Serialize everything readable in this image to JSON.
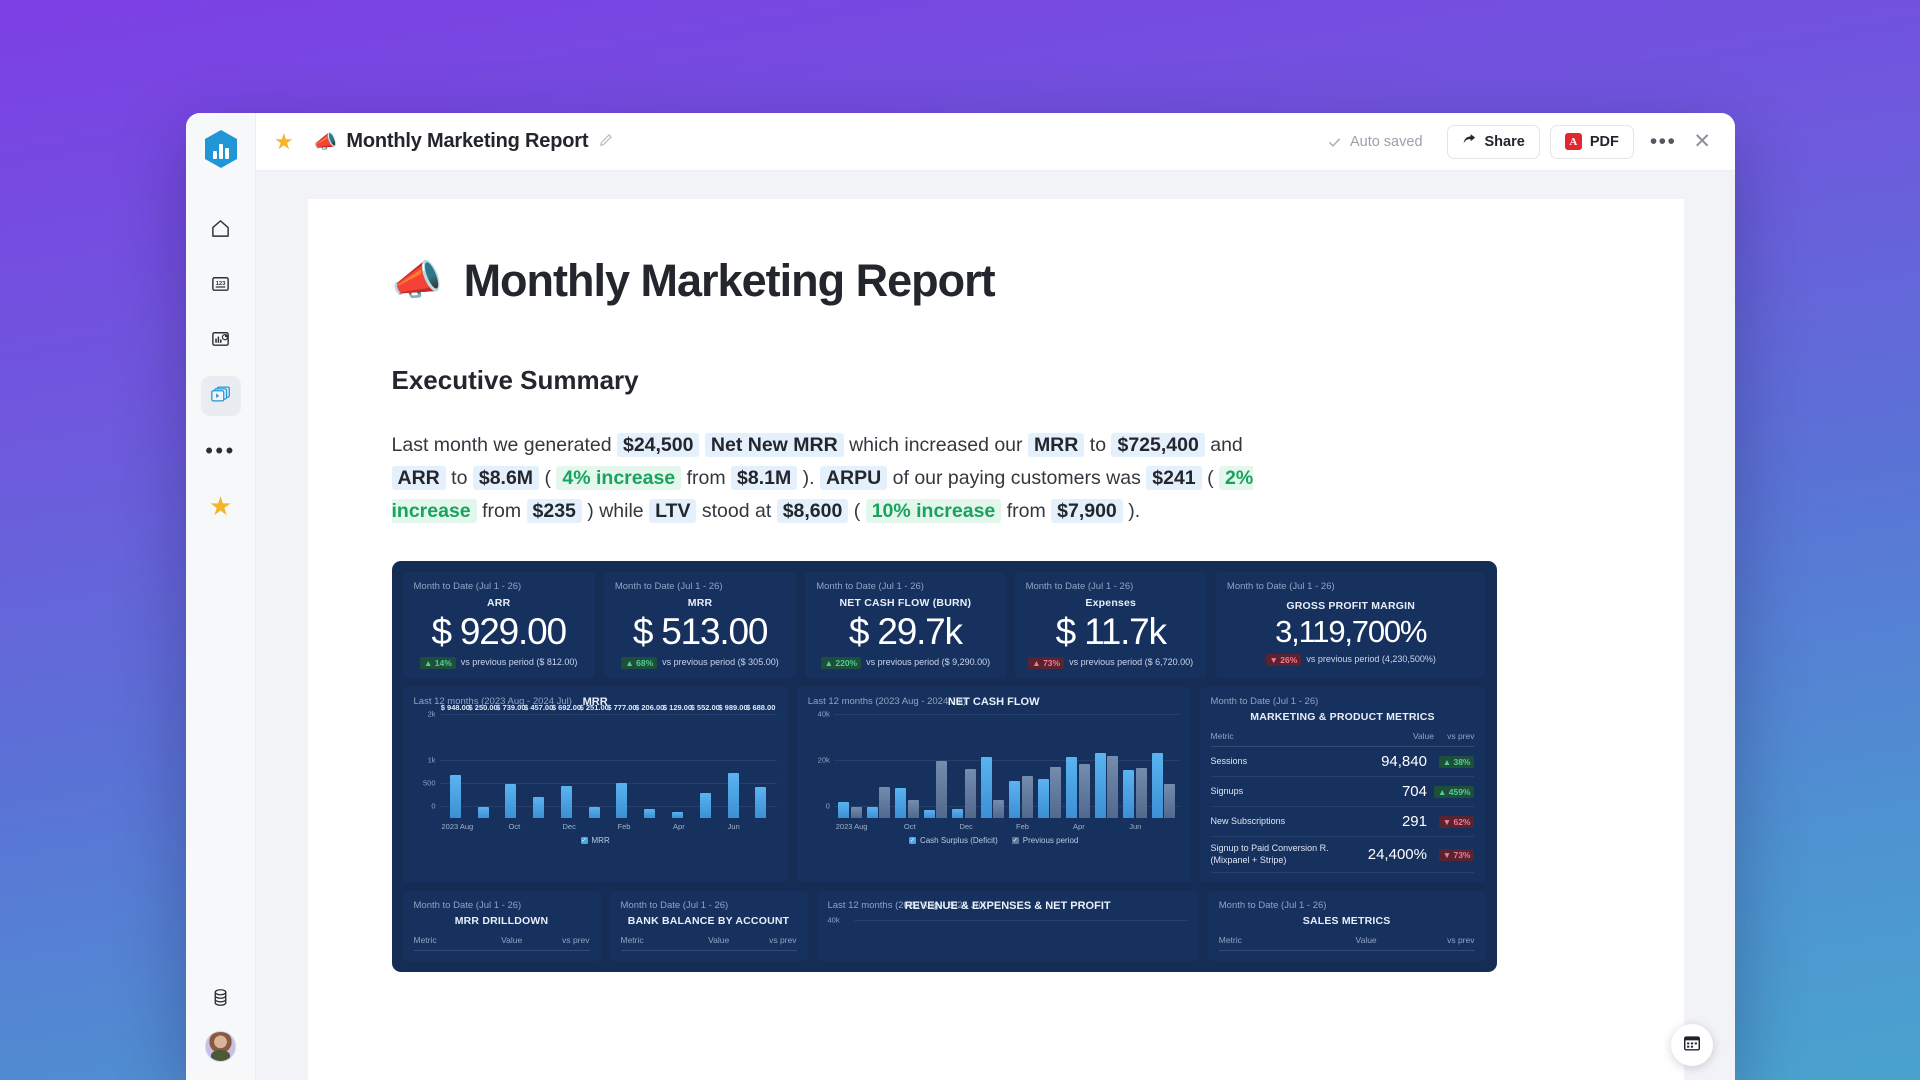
{
  "app": {
    "logo_icon": "hexagon-bar-chart-logo",
    "rail_items": [
      {
        "name": "home",
        "icon": "home-icon",
        "active": false
      },
      {
        "name": "metrics",
        "icon": "numbers-123-icon",
        "active": false
      },
      {
        "name": "dashboards",
        "icon": "dashboard-chart-icon",
        "active": false
      },
      {
        "name": "reports",
        "icon": "slideshow-icon",
        "active": true
      },
      {
        "name": "more",
        "icon": "ellipsis-icon",
        "active": false
      },
      {
        "name": "favorites",
        "icon": "star-icon",
        "active": false
      }
    ],
    "rail_bottom": [
      {
        "name": "data-sources",
        "icon": "database-icon"
      },
      {
        "name": "user-avatar",
        "icon": "avatar"
      }
    ]
  },
  "topbar": {
    "star_icon": "star-icon",
    "doc_emoji": "📣",
    "title": "Monthly Marketing Report",
    "edit_icon": "pencil-icon",
    "autosave_label": "Auto saved",
    "autosave_icon": "check-icon",
    "share_label": "Share",
    "share_icon": "share-arrow-icon",
    "pdf_label": "PDF",
    "pdf_badge_text": "A",
    "more_icon": "ellipsis-icon",
    "close_icon": "close-icon"
  },
  "document": {
    "emoji": "📣",
    "title": "Monthly Marketing Report",
    "section_heading": "Executive Summary",
    "summary": {
      "t1": "Last month we generated ",
      "v_netnew_amount": "$24,500",
      "v_netnew_label": "Net New MRR",
      "t2": " which increased our ",
      "v_mrr_label": "MRR",
      "t3": " to ",
      "v_mrr_amount": "$725,400",
      "t4": " and ",
      "v_arr_label": "ARR",
      "t5": " to ",
      "v_arr_amount": "$8.6M",
      "t6": " ( ",
      "v_arr_change": "4% increase",
      "t7": " from ",
      "v_arr_prev": "$8.1M",
      "t8": " ). ",
      "v_arpu_label": "ARPU",
      "t9": " of our paying customers was ",
      "v_arpu_amount": "$241",
      "t10": " ( ",
      "v_arpu_change": "2% increase",
      "t11": " from ",
      "v_arpu_prev": "$235",
      "t12": " ) while ",
      "v_ltv_label": "LTV",
      "t13": " stood at ",
      "v_ltv_amount": "$8,600",
      "t14": " ( ",
      "v_ltv_change": "10% increase",
      "t15": " from ",
      "v_ltv_prev": "$7,900",
      "t16": " )."
    }
  },
  "dashboard": {
    "kpis": [
      {
        "period": "Month to Date (Jul 1 - 26)",
        "title": "ARR",
        "value": "$ 929.00",
        "change": "▲ 14%",
        "dir": "up",
        "compare": "vs previous period ($ 812.00)"
      },
      {
        "period": "Month to Date (Jul 1 - 26)",
        "title": "MRR",
        "value": "$ 513.00",
        "change": "▲ 68%",
        "dir": "up",
        "compare": "vs previous period ($ 305.00)"
      },
      {
        "period": "Month to Date (Jul 1 - 26)",
        "title": "NET CASH FLOW (BURN)",
        "value": "$ 29.7k",
        "change": "▲ 220%",
        "dir": "up",
        "compare": "vs previous period ($ 9,290.00)"
      },
      {
        "period": "Month to Date (Jul 1 - 26)",
        "title": "Expenses",
        "value": "$ 11.7k",
        "change": "▲ 73%",
        "dir": "down",
        "compare": "vs previous period ($ 6,720.00)"
      },
      {
        "period": "Month to Date (Jul 1 - 26)",
        "title": "GROSS PROFIT MARGIN",
        "value": "3,119,700%",
        "change": "▼ 26%",
        "dir": "down",
        "compare": "vs previous period (4,230,500%)"
      }
    ],
    "marketing_table": {
      "period": "Month to Date (Jul 1 - 26)",
      "title": "MARKETING & PRODUCT METRICS",
      "columns": [
        "Metric",
        "Value",
        "vs prev"
      ],
      "rows": [
        {
          "metric": "Sessions",
          "value": "94,840",
          "change": "▲ 38%",
          "dir": "up"
        },
        {
          "metric": "Signups",
          "value": "704",
          "change": "▲ 459%",
          "dir": "up"
        },
        {
          "metric": "New Subscriptions",
          "value": "291",
          "change": "▼ 62%",
          "dir": "down"
        },
        {
          "metric": "Signup to Paid Conversion R. (Mixpanel + Stripe)",
          "value": "24,400%",
          "change": "▼ 73%",
          "dir": "down"
        }
      ]
    },
    "bottom_cards": [
      {
        "period": "Month to Date (Jul 1 - 26)",
        "title": "MRR DRILLDOWN",
        "columns": [
          "Metric",
          "Value",
          "vs prev"
        ]
      },
      {
        "period": "Month to Date (Jul 1 - 26)",
        "title": "BANK BALANCE BY ACCOUNT",
        "columns": [
          "Metric",
          "Value",
          "vs prev"
        ]
      },
      {
        "period": "Last 12 months (2023 Aug - 2024 Jul)",
        "title": "REVENUE & EXPENSES & NET PROFIT",
        "ytop": "40k"
      },
      {
        "period": "Month to Date (Jul 1 - 26)",
        "title": "SALES METRICS",
        "columns": [
          "Metric",
          "Value",
          "vs prev"
        ]
      }
    ],
    "fab_icon": "calendar-icon"
  },
  "chart_data": [
    {
      "type": "bar",
      "name": "mrr-chart",
      "title": "MRR",
      "subtitle": "Last 12 months (2023 Aug - 2024 Jul)",
      "categories": [
        "2023 Aug",
        "Sep",
        "Oct",
        "Nov",
        "Dec",
        "Jan",
        "Feb",
        "Mar",
        "Apr",
        "May",
        "Jun",
        "Jul"
      ],
      "tick_labels": [
        "2023 Aug",
        "",
        "Oct",
        "",
        "Dec",
        "",
        "Feb",
        "",
        "Apr",
        "",
        "Jun",
        ""
      ],
      "values": [
        948,
        250,
        739,
        457,
        692,
        251,
        777,
        206,
        129,
        552,
        989,
        688
      ],
      "data_labels": [
        "$ 948.00",
        "$ 250.00",
        "$ 739.00",
        "$ 457.00",
        "$ 692.00",
        "$ 251.00",
        "$ 777.00",
        "$ 206.00",
        "$ 129.00",
        "$ 552.00",
        "$ 989.00",
        "$ 688.00"
      ],
      "yticks": [
        "2k",
        "1k",
        "500",
        "0"
      ],
      "ytick_values": [
        2000,
        1000,
        500,
        0
      ],
      "ylim": [
        0,
        2000
      ],
      "legend": [
        {
          "label": "MRR",
          "color": "#4ea8e6"
        }
      ],
      "legend_position": "bottom",
      "grid": true,
      "xlabel": "",
      "ylabel": ""
    },
    {
      "type": "bar",
      "name": "net-cash-flow-chart",
      "title": "NET CASH FLOW",
      "subtitle": "Last 12 months (2023 Aug - 2024 Jul)",
      "categories": [
        "2023 Aug",
        "Sep",
        "Oct",
        "Nov",
        "Dec",
        "Jan",
        "Feb",
        "Mar",
        "Apr",
        "May",
        "Jun",
        "Jul"
      ],
      "tick_labels": [
        "2023 Aug",
        "",
        "Oct",
        "",
        "Dec",
        "",
        "Feb",
        "",
        "Apr",
        "",
        "Jun",
        ""
      ],
      "series": [
        {
          "name": "Cash Surplus (Deficit)",
          "color": "#4ea8e6",
          "values": [
            7000,
            5000,
            13000,
            3500,
            4000,
            26500,
            16000,
            17000,
            26500,
            28500,
            21000,
            28500
          ]
        },
        {
          "name": "Previous period",
          "color": "#60789c",
          "values": [
            5000,
            13500,
            8000,
            25000,
            21500,
            8000,
            18500,
            22500,
            23500,
            27000,
            22000,
            15000
          ]
        }
      ],
      "yticks": [
        "40k",
        "20k",
        "0"
      ],
      "ytick_values": [
        40000,
        20000,
        0
      ],
      "ylim": [
        0,
        40000
      ],
      "legend": [
        {
          "label": "Cash Surplus (Deficit)",
          "color": "#4ea8e6"
        },
        {
          "label": "Previous period",
          "color": "#60789c"
        }
      ],
      "legend_position": "bottom",
      "grid": true,
      "xlabel": "",
      "ylabel": ""
    }
  ]
}
